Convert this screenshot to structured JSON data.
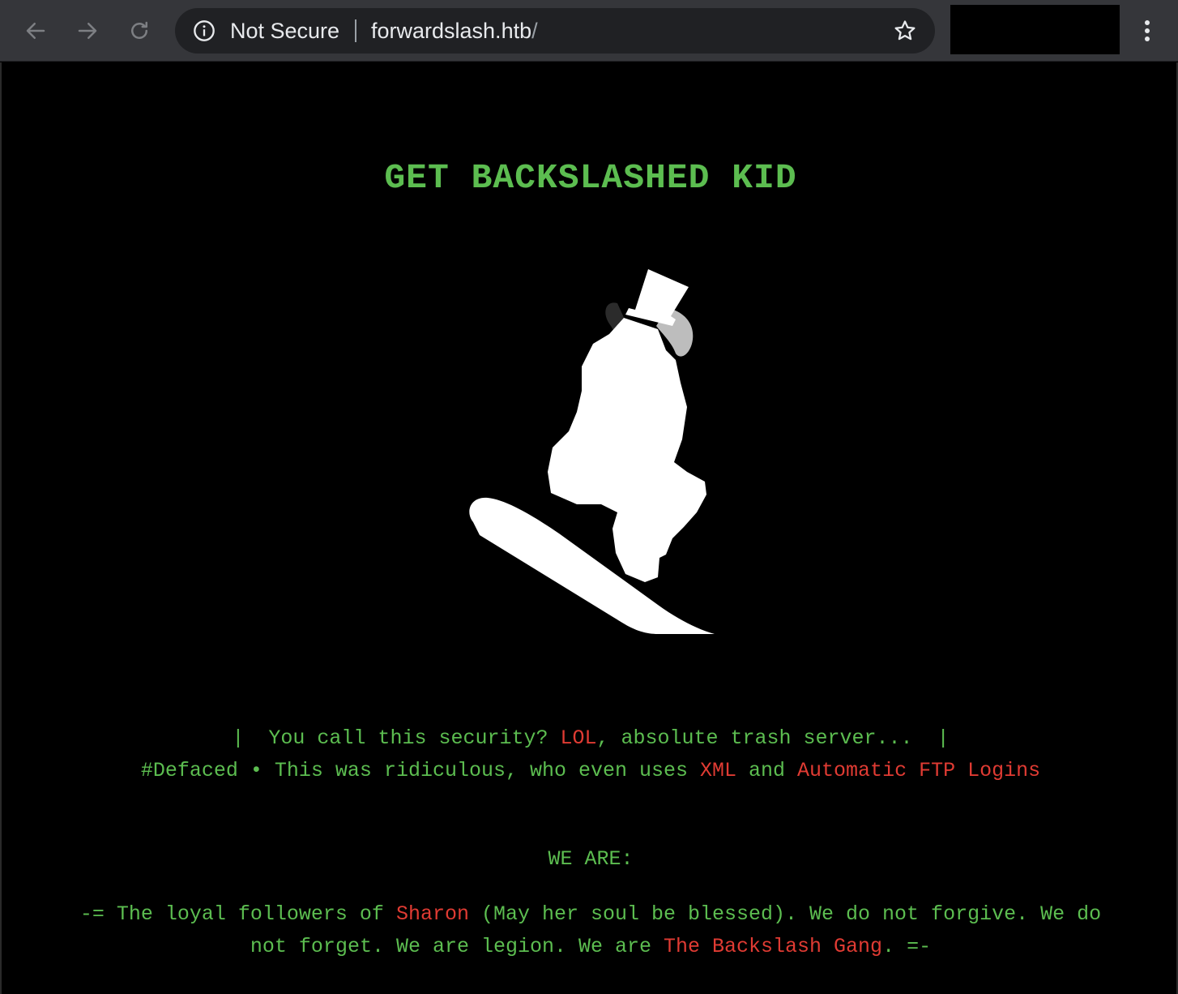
{
  "browser": {
    "security_label": "Not Secure",
    "url_host": "forwardslash.htb",
    "url_path": "/",
    "icons": [
      "back-arrow-icon",
      "forward-arrow-icon",
      "reload-icon",
      "info-icon",
      "star-icon",
      "kebab-menu-icon"
    ]
  },
  "page": {
    "title": "GET BACKSLASHED KID",
    "image": "snowboarder-top-hat-silhouette",
    "colors": {
      "background": "#000000",
      "text_green": "#5cbd50",
      "highlight_red": "#e03b33"
    },
    "line1": {
      "part1": "|  You call this security? ",
      "red1": "LOL",
      "part2": ", absolute trash server...  |"
    },
    "line2": {
      "part1": "#Defaced • This was ridiculous, who even uses ",
      "red1": "XML",
      "part2": " and ",
      "red2": "Automatic FTP Logins"
    },
    "we_are": "WE ARE:",
    "line3": {
      "part1": "-= The loyal followers of ",
      "red1": "Sharon",
      "part2": " (May her soul be blessed). We do not forgive. We do"
    },
    "line4": {
      "part1": "not forget. We are legion. We are ",
      "red1": "The Backslash Gang",
      "part2": ". =-"
    }
  }
}
